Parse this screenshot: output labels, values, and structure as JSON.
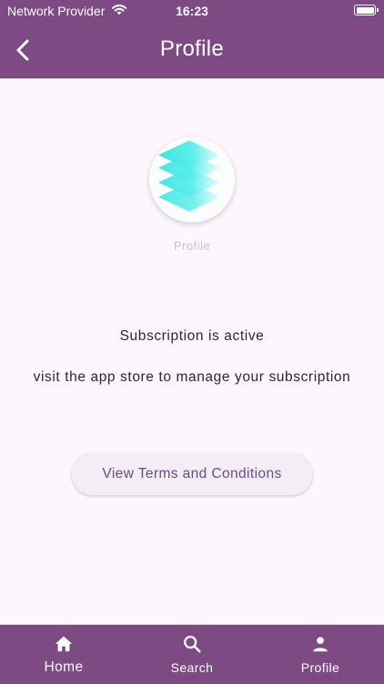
{
  "status_bar": {
    "carrier": "Network Provider",
    "time": "16:23",
    "wifi_icon": "wifi-icon",
    "battery_icon": "battery-full-icon"
  },
  "header": {
    "back_icon": "chevron-left-icon",
    "title": "Profile"
  },
  "profile": {
    "logo_icon": "stacked-layers-logo",
    "caption": "Profile"
  },
  "subscription": {
    "status": "Subscription is active",
    "info": "visit the app store to manage your subscription"
  },
  "actions": {
    "terms_label": "View Terms and Conditions"
  },
  "bottom_nav": {
    "items": [
      {
        "label": "Home",
        "icon": "home-icon",
        "active": true
      },
      {
        "label": "Search",
        "icon": "search-icon",
        "active": false
      },
      {
        "label": "Profile",
        "icon": "person-icon",
        "active": false
      }
    ]
  },
  "colors": {
    "primary": "#7d4a83",
    "background": "#fdf7fd",
    "button_bg": "#f3edf6",
    "button_text": "#6a4b8c",
    "logo_accent": "#3ee6e6"
  }
}
